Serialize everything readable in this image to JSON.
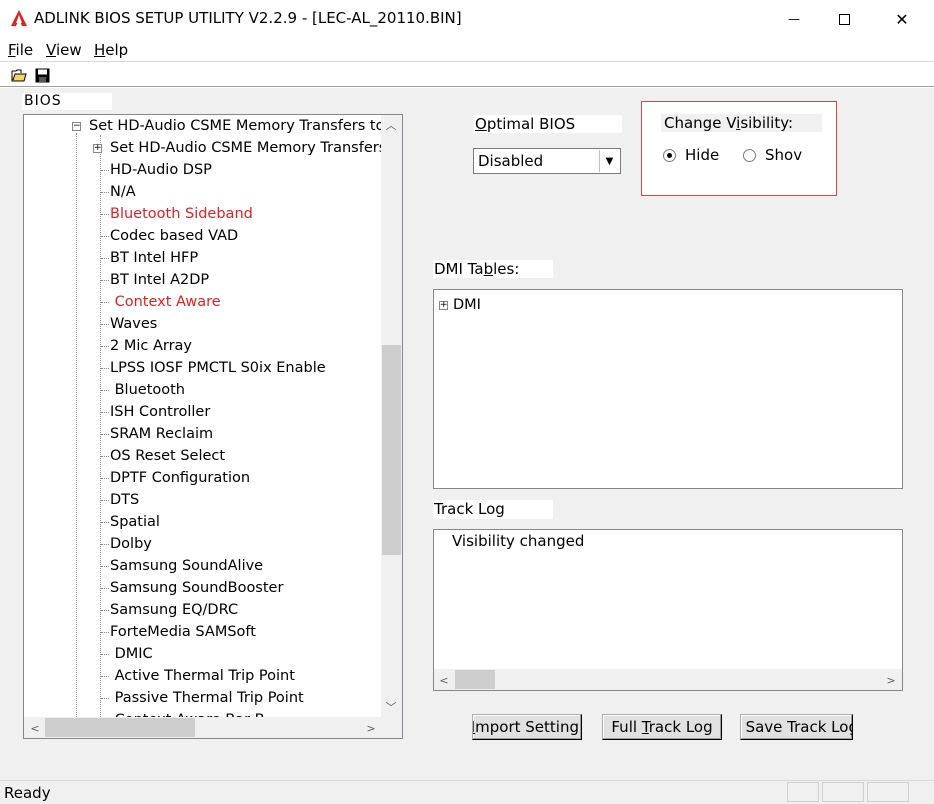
{
  "window": {
    "title": "ADLINK BIOS SETUP UTILITY  V2.2.9  - [LEC-AL_20110.BIN]",
    "minimize_glyph": "—",
    "maximize_glyph": "☐",
    "close_glyph": "✕"
  },
  "menu": {
    "file_u": "F",
    "file_rest": "ile",
    "view_u": "V",
    "view_rest": "iew",
    "help_u": "H",
    "help_rest": "elp"
  },
  "toolbar": {
    "icons": [
      "open-folder-icon",
      "save-disk-icon"
    ]
  },
  "bios_panel": {
    "label": "BIOS",
    "tree": [
      {
        "label": "Set HD-Audio CSME Memory Transfers to",
        "color": "#000000",
        "expander": "−"
      },
      {
        "label": "Set HD-Audio CSME Memory Transfers",
        "color": "#000000",
        "expander": "+"
      },
      {
        "label": "HD-Audio DSP",
        "color": "#000000"
      },
      {
        "label": "N/A",
        "color": "#000000"
      },
      {
        "label": "Bluetooth Sideband",
        "color": "#e02020"
      },
      {
        "label": "Codec based VAD",
        "color": "#000000"
      },
      {
        "label": "BT Intel HFP",
        "color": "#000000"
      },
      {
        "label": "BT Intel A2DP",
        "color": "#000000"
      },
      {
        "label": " Context Aware",
        "color": "#e02020"
      },
      {
        "label": "Waves",
        "color": "#000000"
      },
      {
        "label": "2 Mic Array",
        "color": "#000000"
      },
      {
        "label": "LPSS IOSF PMCTL S0ix Enable",
        "color": "#000000"
      },
      {
        "label": " Bluetooth",
        "color": "#000000"
      },
      {
        "label": "ISH Controller",
        "color": "#000000"
      },
      {
        "label": "SRAM Reclaim",
        "color": "#000000"
      },
      {
        "label": "OS Reset Select",
        "color": "#000000"
      },
      {
        "label": "DPTF Configuration",
        "color": "#000000"
      },
      {
        "label": "DTS",
        "color": "#000000"
      },
      {
        "label": "Spatial",
        "color": "#000000"
      },
      {
        "label": "Dolby",
        "color": "#000000"
      },
      {
        "label": "Samsung SoundAlive",
        "color": "#000000"
      },
      {
        "label": "Samsung SoundBooster",
        "color": "#000000"
      },
      {
        "label": "Samsung EQ/DRC",
        "color": "#000000"
      },
      {
        "label": "ForteMedia SAMSoft",
        "color": "#000000"
      },
      {
        "label": " DMIC",
        "color": "#000000"
      },
      {
        "label": " Active Thermal Trip Point",
        "color": "#000000"
      },
      {
        "label": " Passive Thermal Trip Point",
        "color": "#000000"
      },
      {
        "label": " Context Aware Bar B",
        "color": "#000000"
      }
    ]
  },
  "optimal_bios": {
    "label_u": "O",
    "label_rest": "ptimal BIOS",
    "value": "Disabled"
  },
  "visibility": {
    "label_pre": "Change V",
    "label_u": "i",
    "label_rest": "sibility:",
    "options": [
      {
        "label": "Hide",
        "selected": true
      },
      {
        "label": "Shov",
        "selected": false
      }
    ]
  },
  "dmi": {
    "label_pre": "DMI Ta",
    "label_u": "b",
    "label_rest": "les:",
    "tree": [
      {
        "label": "DMI",
        "expander": "+"
      }
    ]
  },
  "track_log": {
    "label": "Track Log",
    "entries": [
      "Visibility changed"
    ]
  },
  "buttons": {
    "import": {
      "pre": "",
      "u": "I",
      "rest": "mport Setting"
    },
    "full_track": {
      "pre": "Full ",
      "u": "T",
      "rest": "rack Log"
    },
    "save_track": {
      "pre": "Save Track Lo",
      "u": "",
      "rest": "g"
    }
  },
  "status": {
    "text": "Ready"
  },
  "colors": {
    "accent_red": "#e02020",
    "border_red": "#d44848",
    "app_icon_red": "#d9231c"
  }
}
